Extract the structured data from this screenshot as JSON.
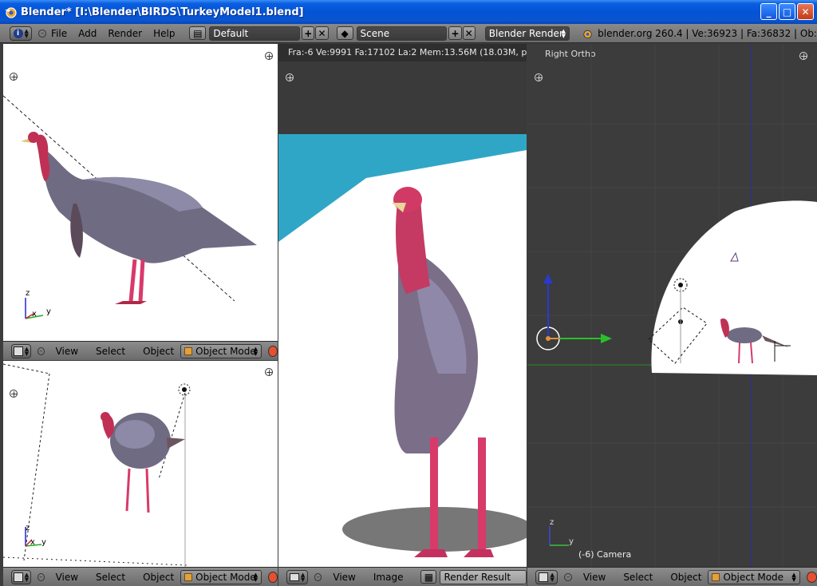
{
  "window": {
    "title": "Blender* [I:\\Blender\\BIRDS\\TurkeyModel1.blend]",
    "minimize_label": "_",
    "maximize_label": "□",
    "close_label": "✕"
  },
  "info_header": {
    "menus": [
      "File",
      "Add",
      "Render",
      "Help"
    ],
    "screen_layout": "Default",
    "scene": "Scene",
    "render_engine": "Blender Render",
    "stats": "blender.org 260.4 | Ve:36923 | Fa:36832 | Ob:"
  },
  "viewport_top_left": {
    "axis_x": "x",
    "axis_y": "y",
    "axis_z": "z",
    "header": {
      "menus": [
        "View",
        "Select",
        "Object"
      ],
      "mode": "Object Mode"
    }
  },
  "viewport_bottom_left": {
    "axis_x": "x",
    "axis_y": "y",
    "axis_z": "z",
    "header": {
      "menus": [
        "View",
        "Select",
        "Object"
      ],
      "mode": "Object Mode"
    }
  },
  "render_area": {
    "info_text": "Fra:-6  Ve:9991 Fa:17102 La:2 Mem:13.56M (18.03M, pea",
    "header": {
      "menus": [
        "View",
        "Image"
      ],
      "image_name": "Render Result"
    }
  },
  "viewport_right": {
    "view_label": "Right Ortho",
    "object_label": "(-6) Camera",
    "axis_y": "y",
    "axis_z": "z",
    "header": {
      "menus": [
        "View",
        "Select",
        "Object"
      ],
      "mode": "Object Mode"
    }
  },
  "colors": {
    "title_bar": "#0453d6",
    "header_gray": "#7c7c7c",
    "viewport_dark": "#3c3c3c",
    "render_sky": "#30a6c6",
    "turkey_head": "#d83a6a",
    "axis_x": "#c22",
    "axis_y": "#2a2",
    "axis_z": "#22c"
  }
}
